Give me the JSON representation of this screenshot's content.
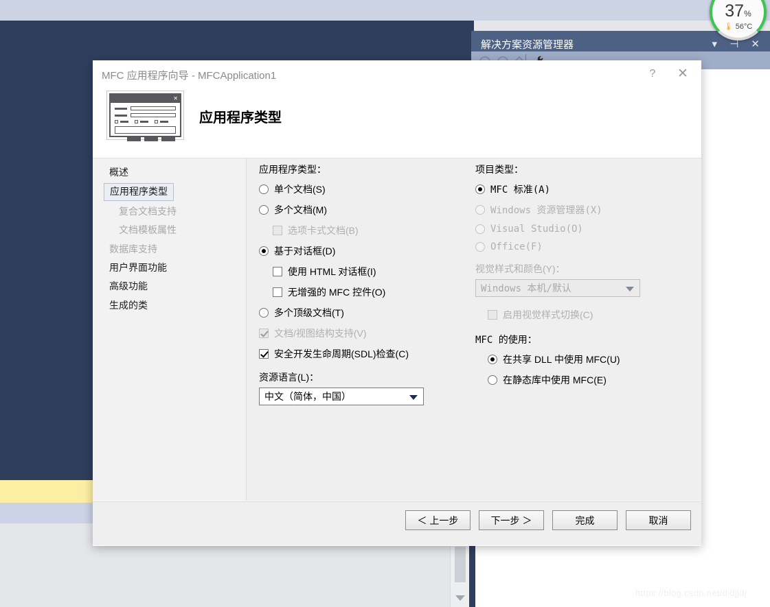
{
  "background": {
    "solution_explorer": {
      "title": "解决方案资源管理器",
      "window_buttons": "▾ ⊣ ✕",
      "toolbar_icons": [
        "back-icon",
        "forward-icon",
        "home-icon",
        "wrench-icon"
      ]
    },
    "gauge": {
      "percent": "37",
      "percent_unit": "%",
      "temperature": "56°C",
      "thermometer_icon": "🌡",
      "ring_color": "#3dc453"
    },
    "watermark": "https://blog.csdn.net/didjjdj"
  },
  "dialog": {
    "title": "MFC 应用程序向导 - MFCApplication1",
    "help_button": "?",
    "close_button": "✕",
    "header_title": "应用程序类型",
    "nav": {
      "items": [
        {
          "label": "概述",
          "state": "normal",
          "level": 0
        },
        {
          "label": "应用程序类型",
          "state": "selected",
          "level": 0
        },
        {
          "label": "复合文档支持",
          "state": "disabled",
          "level": 1
        },
        {
          "label": "文档模板属性",
          "state": "disabled",
          "level": 1
        },
        {
          "label": "数据库支持",
          "state": "disabled",
          "level": 0
        },
        {
          "label": "用户界面功能",
          "state": "normal",
          "level": 0
        },
        {
          "label": "高级功能",
          "state": "normal",
          "level": 0
        },
        {
          "label": "生成的类",
          "state": "normal",
          "level": 0
        }
      ]
    },
    "app_type": {
      "group_label": "应用程序类型：",
      "options": [
        {
          "type": "radio",
          "label": "单个文档(S)",
          "checked": false,
          "disabled": false,
          "indent": 0
        },
        {
          "type": "radio",
          "label": "多个文档(M)",
          "checked": false,
          "disabled": false,
          "indent": 0
        },
        {
          "type": "checkbox",
          "label": "选项卡式文档(B)",
          "checked": false,
          "disabled": true,
          "indent": 1
        },
        {
          "type": "radio",
          "label": "基于对话框(D)",
          "checked": true,
          "disabled": false,
          "indent": 0
        },
        {
          "type": "checkbox",
          "label": "使用 HTML 对话框(I)",
          "checked": false,
          "disabled": false,
          "indent": 1
        },
        {
          "type": "checkbox",
          "label": "无增强的 MFC 控件(O)",
          "checked": false,
          "disabled": false,
          "indent": 1
        },
        {
          "type": "radio",
          "label": "多个顶级文档(T)",
          "checked": false,
          "disabled": false,
          "indent": 0
        },
        {
          "type": "checkbox",
          "label": "文档/视图结构支持(V)",
          "checked": true,
          "disabled": true,
          "indent": 0
        },
        {
          "type": "checkbox",
          "label": "安全开发生命周期(SDL)检查(C)",
          "checked": true,
          "disabled": false,
          "indent": 0
        }
      ]
    },
    "resource_language": {
      "label": "资源语言(L)：",
      "value": "中文（简体，中国）"
    },
    "project_type": {
      "group_label": "项目类型：",
      "options": [
        {
          "type": "radio",
          "label": "MFC 标准(A)",
          "checked": true,
          "disabled": false
        },
        {
          "type": "radio",
          "label": "Windows 资源管理器(X)",
          "checked": false,
          "disabled": true
        },
        {
          "type": "radio",
          "label": "Visual Studio(O)",
          "checked": false,
          "disabled": true
        },
        {
          "type": "radio",
          "label": "Office(F)",
          "checked": false,
          "disabled": true
        }
      ]
    },
    "visual_style": {
      "label": "视觉样式和颜色(Y)：",
      "value": "Windows 本机/默认",
      "disabled": true,
      "toggle": {
        "type": "checkbox",
        "label": "启用视觉样式切换(C)",
        "checked": false,
        "disabled": true
      }
    },
    "mfc_usage": {
      "group_label": "MFC 的使用：",
      "options": [
        {
          "type": "radio",
          "label": "在共享 DLL 中使用 MFC(U)",
          "checked": true,
          "disabled": false
        },
        {
          "type": "radio",
          "label": "在静态库中使用 MFC(E)",
          "checked": false,
          "disabled": false
        }
      ]
    },
    "footer": {
      "buttons": [
        {
          "label": "＜ 上一步",
          "name": "back-button"
        },
        {
          "label": "下一步 ＞",
          "name": "next-button"
        },
        {
          "label": "完成",
          "name": "finish-button"
        },
        {
          "label": "取消",
          "name": "cancel-button"
        }
      ]
    }
  }
}
